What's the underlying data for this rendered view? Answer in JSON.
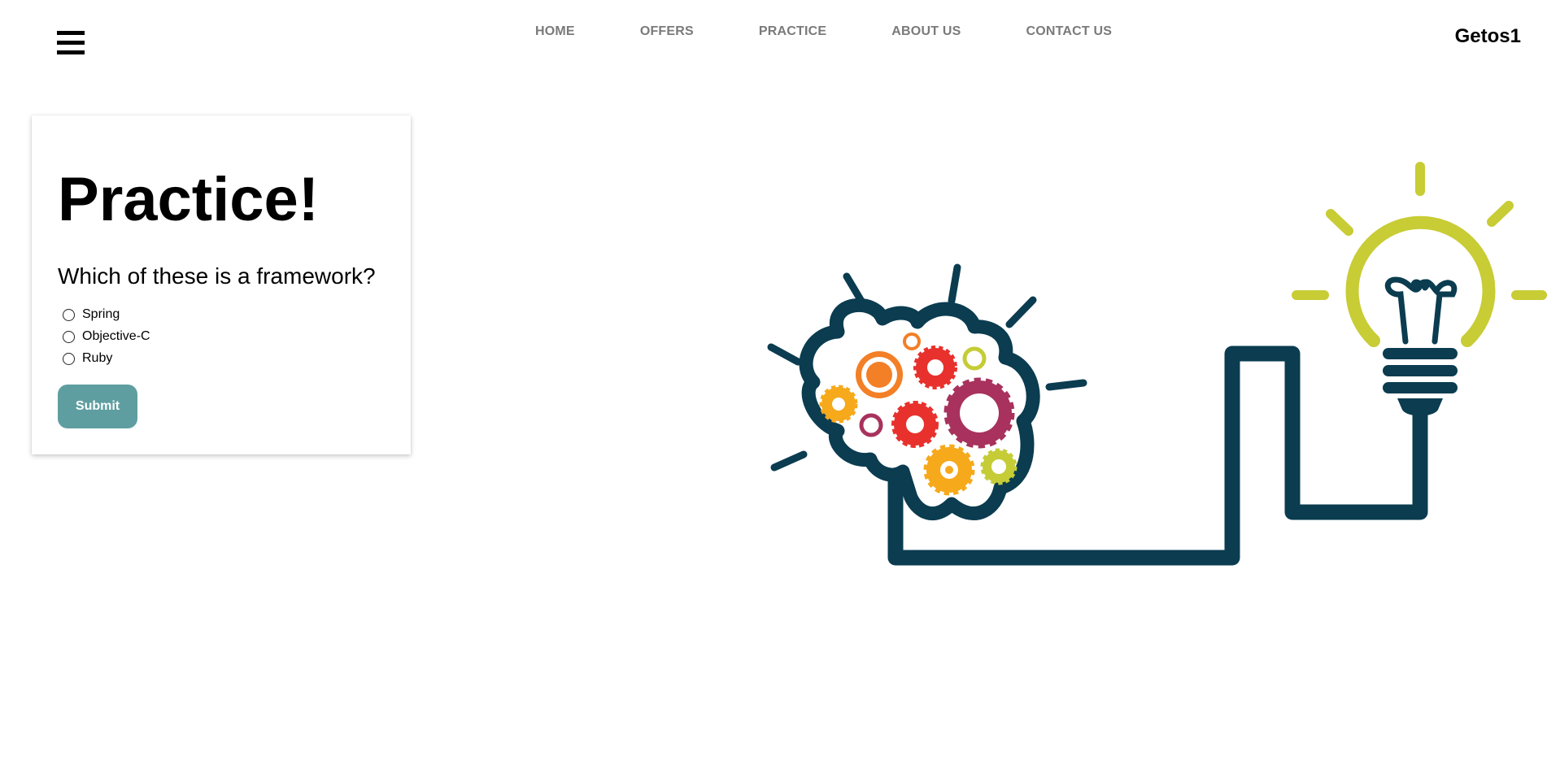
{
  "header": {
    "menu_icon": "hamburger-menu-icon",
    "nav": [
      {
        "label": "HOME"
      },
      {
        "label": "OFFERS"
      },
      {
        "label": "PRACTICE"
      },
      {
        "label": "ABOUT US"
      },
      {
        "label": "CONTACT US"
      }
    ],
    "brand": "Getos1"
  },
  "quiz": {
    "title": "Practice!",
    "question": "Which of these is a framework?",
    "options": [
      {
        "label": "Spring"
      },
      {
        "label": "Objective-C"
      },
      {
        "label": "Ruby"
      }
    ],
    "submit_label": "Submit"
  },
  "illustration": {
    "icon": "brain-gears-lightbulb-icon"
  },
  "colors": {
    "nav_text": "#7a7a7a",
    "submit_bg": "#5f9ea0",
    "brain_outline": "#0b3c50",
    "bulb": "#c8cc35",
    "gear_orange": "#f37f26",
    "gear_red": "#e8312d",
    "gear_purple": "#a8325d",
    "gear_yellow": "#f6a91b",
    "gear_lime": "#c5cc36"
  }
}
